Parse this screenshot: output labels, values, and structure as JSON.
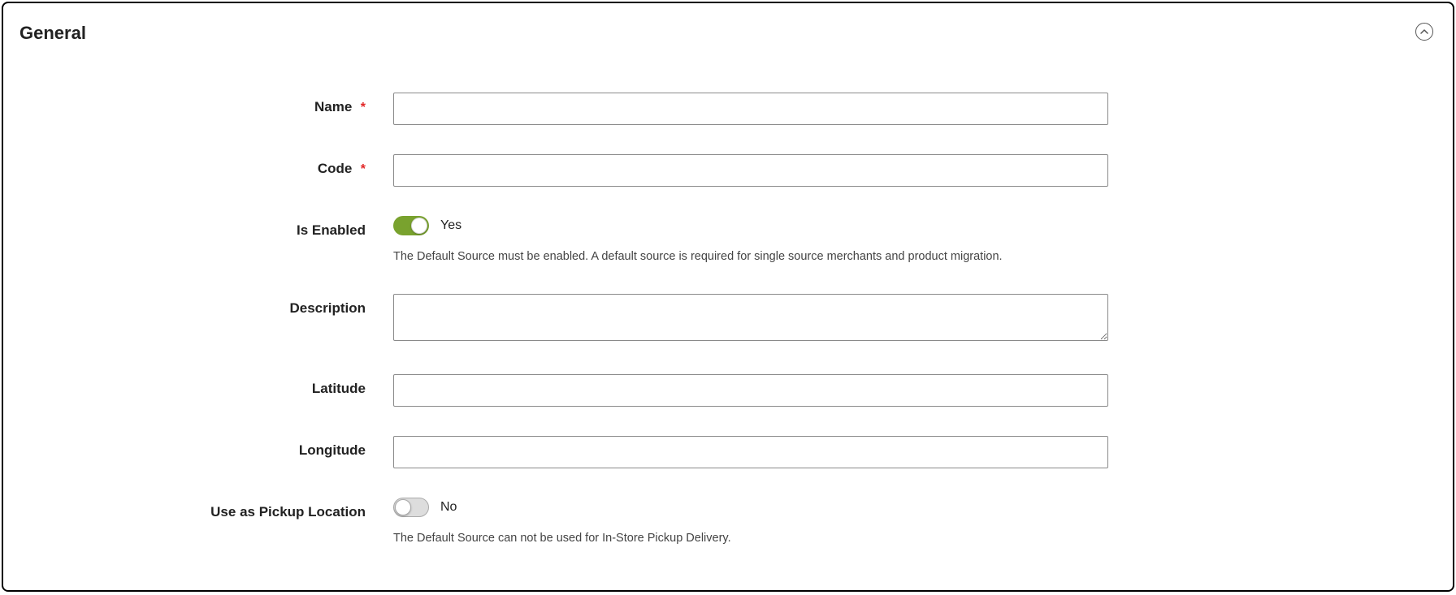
{
  "panel": {
    "title": "General"
  },
  "fields": {
    "name": {
      "label": "Name",
      "required_mark": "*",
      "value": ""
    },
    "code": {
      "label": "Code",
      "required_mark": "*",
      "value": ""
    },
    "is_enabled": {
      "label": "Is Enabled",
      "state_label": "Yes",
      "helper": "The Default Source must be enabled. A default source is required for single source merchants and product migration."
    },
    "description": {
      "label": "Description",
      "value": ""
    },
    "latitude": {
      "label": "Latitude",
      "value": ""
    },
    "longitude": {
      "label": "Longitude",
      "value": ""
    },
    "pickup": {
      "label": "Use as Pickup Location",
      "state_label": "No",
      "helper": "The Default Source can not be used for In-Store Pickup Delivery."
    }
  }
}
